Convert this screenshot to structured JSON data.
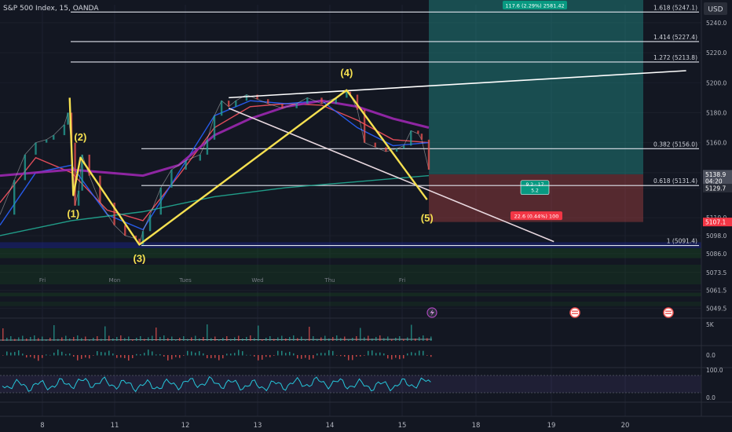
{
  "header": {
    "title": "S&P 500 Index, 15, OANDA",
    "currency": "USD"
  },
  "chart_data": {
    "type": "line",
    "title": "S&P 500 Index, 15, OANDA",
    "ylim": [
      5043,
      5252
    ],
    "y_ticks": [
      5240.0,
      5220.0,
      5200.0,
      5180.0,
      5160.0,
      5140.0,
      5129.7,
      5110.0,
      5098.0,
      5086.0,
      5073.5,
      5061.5,
      5049.5
    ],
    "x_tick_labels": [
      "8",
      "11",
      "12",
      "13",
      "14",
      "15",
      "18",
      "19",
      "20"
    ],
    "day_labels": [
      "Fri",
      "Mon",
      "Tues",
      "Wed",
      "Thu",
      "Fri"
    ],
    "price_path": [
      [
        0,
        5112
      ],
      [
        4,
        5135
      ],
      [
        7,
        5152
      ],
      [
        10,
        5160
      ],
      [
        13,
        5162
      ],
      [
        15,
        5165
      ],
      [
        18,
        5172
      ],
      [
        19,
        5180
      ],
      [
        20,
        5160
      ],
      [
        21,
        5118
      ],
      [
        22,
        5128
      ],
      [
        23,
        5152
      ],
      [
        25,
        5138
      ],
      [
        28,
        5120
      ],
      [
        32,
        5105
      ],
      [
        35,
        5098
      ],
      [
        38,
        5096
      ],
      [
        39,
        5092
      ],
      [
        40,
        5101
      ],
      [
        42,
        5112
      ],
      [
        45,
        5130
      ],
      [
        48,
        5142
      ],
      [
        52,
        5148
      ],
      [
        56,
        5152
      ],
      [
        58,
        5162
      ],
      [
        60,
        5178
      ],
      [
        62,
        5188
      ],
      [
        64,
        5184
      ],
      [
        66,
        5188
      ],
      [
        69,
        5192
      ],
      [
        72,
        5189
      ],
      [
        75,
        5186
      ],
      [
        79,
        5183
      ],
      [
        83,
        5186
      ],
      [
        86,
        5190
      ],
      [
        90,
        5186
      ],
      [
        94,
        5190
      ],
      [
        97,
        5194
      ],
      [
        98,
        5192
      ],
      [
        100,
        5182
      ],
      [
        102,
        5160
      ],
      [
        105,
        5157
      ],
      [
        108,
        5154
      ],
      [
        111,
        5156
      ],
      [
        113,
        5158
      ],
      [
        115,
        5168
      ],
      [
        117,
        5166
      ],
      [
        118,
        5162
      ],
      [
        120,
        5142
      ]
    ],
    "series": [
      {
        "name": "",
        "color": "#f7525f",
        "values": [
          [
            0,
            5120
          ],
          [
            10,
            5150
          ],
          [
            20,
            5140
          ],
          [
            30,
            5115
          ],
          [
            40,
            5108
          ],
          [
            50,
            5138
          ],
          [
            60,
            5170
          ],
          [
            70,
            5184
          ],
          [
            80,
            5186
          ],
          [
            90,
            5185
          ],
          [
            100,
            5175
          ],
          [
            110,
            5162
          ],
          [
            120,
            5160
          ]
        ]
      },
      {
        "name": "",
        "color": "#2962ff",
        "values": [
          [
            0,
            5105
          ],
          [
            10,
            5140
          ],
          [
            20,
            5145
          ],
          [
            30,
            5112
          ],
          [
            40,
            5102
          ],
          [
            50,
            5140
          ],
          [
            60,
            5178
          ],
          [
            70,
            5188
          ],
          [
            80,
            5186
          ],
          [
            90,
            5188
          ],
          [
            100,
            5170
          ],
          [
            110,
            5158
          ],
          [
            120,
            5160
          ]
        ]
      },
      {
        "name": "",
        "color": "#9c27b0",
        "values": [
          [
            0,
            5138
          ],
          [
            10,
            5140
          ],
          [
            20,
            5142
          ],
          [
            30,
            5140
          ],
          [
            40,
            5138
          ],
          [
            50,
            5145
          ],
          [
            60,
            5165
          ],
          [
            70,
            5176
          ],
          [
            80,
            5184
          ],
          [
            90,
            5188
          ],
          [
            100,
            5184
          ],
          [
            110,
            5176
          ],
          [
            120,
            5170
          ]
        ]
      },
      {
        "name": "",
        "color": "#22ab94",
        "values": [
          [
            0,
            5098
          ],
          [
            20,
            5108
          ],
          [
            40,
            5114
          ],
          [
            60,
            5124
          ],
          [
            80,
            5130
          ],
          [
            100,
            5134
          ],
          [
            120,
            5138
          ]
        ]
      }
    ],
    "elliott_waves": [
      {
        "label": "(1)",
        "x": 20.5,
        "y": 5125,
        "label_y": 5113
      },
      {
        "label": "(2)",
        "x": 22.5,
        "y": 5150,
        "label_y": 5164
      },
      {
        "label": "(3)",
        "x": 39,
        "y": 5092,
        "label_y": 5083
      },
      {
        "label": "(4)",
        "x": 97,
        "y": 5195,
        "label_y": 5207
      },
      {
        "label": "(5)",
        "x": 119.5,
        "y": 5122,
        "label_y": 5110
      }
    ],
    "wave_start": [
      19.5,
      5190
    ],
    "fib_levels": [
      {
        "label": "1.618 (5247.1)",
        "value": 5247.1
      },
      {
        "label": "1.414 (5227.4)",
        "value": 5227.4
      },
      {
        "label": "1.272 (5213.8)",
        "value": 5213.8
      },
      {
        "label": "0.382 (5156.0)",
        "value": 5156.0
      },
      {
        "label": "0.618 (5131.4)",
        "value": 5131.4
      },
      {
        "label": "1 (5091.4)",
        "value": 5091.4
      }
    ],
    "trendlines": [
      {
        "from": [
          64,
          5190
        ],
        "to": [
          192,
          5208
        ],
        "color": "#ffffff"
      },
      {
        "from": [
          64,
          5183
        ],
        "to": [
          155,
          5094
        ],
        "color": "#ffffff"
      }
    ],
    "position": {
      "entry_x": 120,
      "exit_x": 180,
      "entry": 5138.9,
      "target": 5256,
      "stop": 5107.1,
      "target_label": "117.6 (2.29%) 2581.42",
      "stop_label": "22.6 (0.44%) 100",
      "ratio_label_1": "9.2 · 17",
      "ratio_label_2": "5.2"
    },
    "price_tags": [
      {
        "label": "5138.9",
        "value": 5138.9,
        "color": "#4b4f5c"
      },
      {
        "label": "04:20",
        "value": 5134.3,
        "color": "#4b4f5c"
      },
      {
        "label": "5129.7",
        "value": 5129.7,
        "color": "#2a2e39"
      },
      {
        "label": "5107.1",
        "value": 5107.1,
        "color": "#f23645"
      }
    ],
    "volume_axis_label": "5K",
    "macd_axis_label": "0.0",
    "rsi_axis_labels": [
      "100.0",
      "0.0"
    ]
  }
}
